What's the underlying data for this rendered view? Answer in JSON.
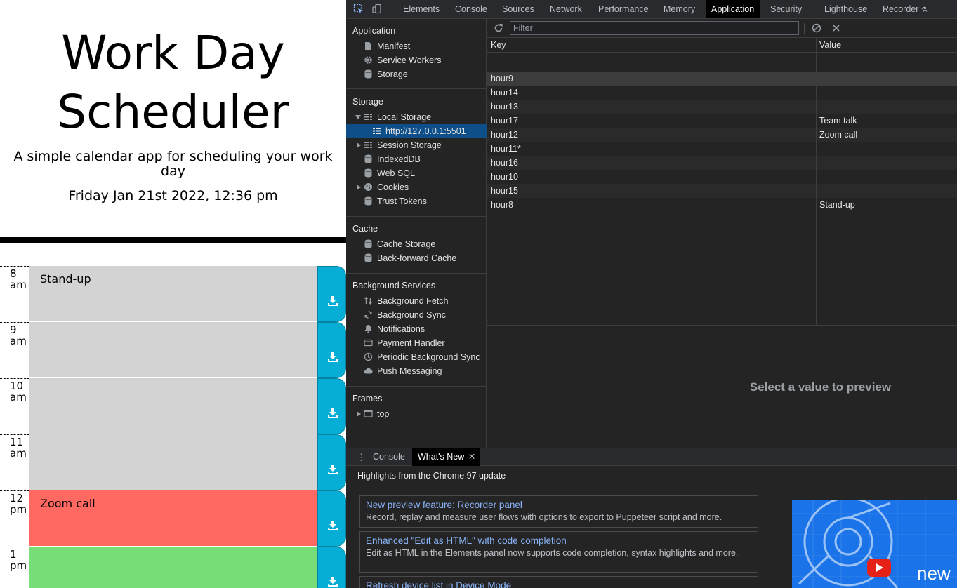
{
  "app": {
    "title_line1": "Work Day",
    "title_line2": "Scheduler",
    "subtitle": "A simple calendar app for scheduling your work day",
    "current_date": "Friday Jan 21st 2022, 12:36 pm",
    "rows": [
      {
        "hour": "8",
        "ampm": "am",
        "text": "Stand-up",
        "state": "past"
      },
      {
        "hour": "9",
        "ampm": "am",
        "text": "",
        "state": "past"
      },
      {
        "hour": "10",
        "ampm": "am",
        "text": "",
        "state": "past"
      },
      {
        "hour": "11",
        "ampm": "am",
        "text": "",
        "state": "past"
      },
      {
        "hour": "12",
        "ampm": "pm",
        "text": "Zoom call",
        "state": "present"
      },
      {
        "hour": "1",
        "ampm": "pm",
        "text": "",
        "state": "future"
      }
    ],
    "colors": {
      "past": "#d3d3d3",
      "present": "#ff6961",
      "future": "#77dd77",
      "save": "#06aed5"
    }
  },
  "devtools": {
    "tabs": [
      "Elements",
      "Console",
      "Sources",
      "Network",
      "Performance",
      "Memory",
      "Application",
      "Security",
      "Lighthouse",
      "Recorder"
    ],
    "active_tab": "Application",
    "sidebar": {
      "application_title": "Application",
      "application_items": [
        "Manifest",
        "Service Workers",
        "Storage"
      ],
      "storage_title": "Storage",
      "storage_items": [
        "Local Storage",
        "http://127.0.0.1:5501",
        "Session Storage",
        "IndexedDB",
        "Web SQL",
        "Cookies",
        "Trust Tokens"
      ],
      "cache_title": "Cache",
      "cache_items": [
        "Cache Storage",
        "Back-forward Cache"
      ],
      "bg_title": "Background Services",
      "bg_items": [
        "Background Fetch",
        "Background Sync",
        "Notifications",
        "Payment Handler",
        "Periodic Background Sync",
        "Push Messaging"
      ],
      "frames_title": "Frames",
      "frames_items": [
        "top"
      ]
    },
    "filter_placeholder": "Filter",
    "table": {
      "key_header": "Key",
      "value_header": "Value",
      "rows": [
        {
          "key": "hour9",
          "value": ""
        },
        {
          "key": "hour14",
          "value": ""
        },
        {
          "key": "hour13",
          "value": ""
        },
        {
          "key": "hour17",
          "value": "Team talk"
        },
        {
          "key": "hour12",
          "value": "Zoom call"
        },
        {
          "key": "hour11*",
          "value": ""
        },
        {
          "key": "hour16",
          "value": ""
        },
        {
          "key": "hour10",
          "value": ""
        },
        {
          "key": "hour15",
          "value": ""
        },
        {
          "key": "hour8",
          "value": "Stand-up"
        }
      ]
    },
    "preview_text": "Select a value to preview",
    "drawer": {
      "tabs": [
        "Console",
        "What's New"
      ],
      "active_tab": "What's New",
      "highlights_title": "Highlights from the Chrome 97 update",
      "cards": [
        {
          "title": "New preview feature: Recorder panel",
          "desc": "Record, replay and measure user flows with options to export to Puppeteer script and more."
        },
        {
          "title": "Enhanced \"Edit as HTML\" with code completion",
          "desc": "Edit as HTML in the Elements panel now supports code completion, syntax highlights and more."
        },
        {
          "title": "Refresh device list in Device Mode",
          "desc": ""
        }
      ],
      "promo_text": "new"
    }
  }
}
